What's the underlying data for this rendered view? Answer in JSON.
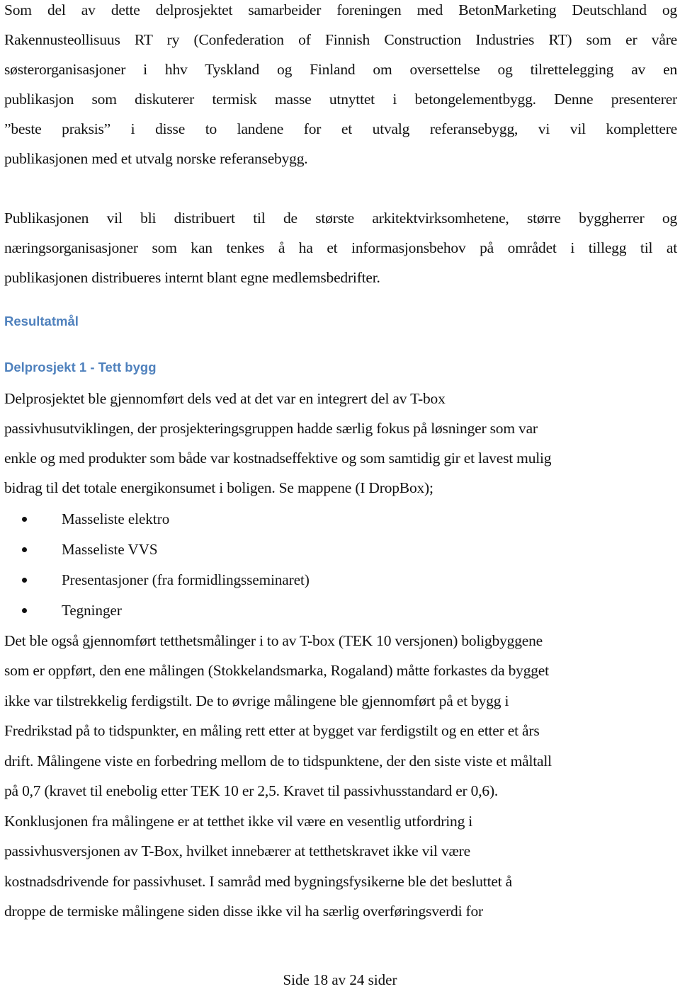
{
  "document": {
    "paragraph1": [
      "Som del av dette delprosjektet samarbeider foreningen med BetonMarketing Deutschland og",
      "Rakennusteollisuus RT ry (Confederation of Finnish Construction Industries RT) som er våre",
      "søsterorganisasjoner i hhv Tyskland og Finland om oversettelse og tilrettelegging av en",
      "publikasjon som diskuterer termisk masse utnyttet i betongelementbygg. Denne presenterer",
      "”beste praksis” i disse to landene for et utvalg referansebygg, vi vil komplettere",
      "publikasjonen med et utvalg norske referansebygg."
    ],
    "paragraph2": [
      "Publikasjonen vil bli distribuert til de største arkitektvirksomhetene, større byggherrer og",
      "næringsorganisasjoner som kan tenkes å ha et informasjonsbehov på området i tillegg til at",
      "publikasjonen distribueres internt blant egne medlemsbedrifter."
    ],
    "heading1": "Resultatmål",
    "heading2": "Delprosjekt 1 - Tett bygg",
    "paragraph3": [
      "Delprosjektet ble gjennomført dels ved at det var en integrert del av T-box",
      "passivhusutviklingen, der prosjekteringsgruppen hadde særlig fokus på løsninger som var",
      "enkle og med produkter som både var kostnadseffektive og som samtidig gir et lavest mulig",
      "bidrag til det totale energikonsumet i boligen. Se mappene (I DropBox);"
    ],
    "bullets": [
      "Masseliste elektro",
      "Masseliste VVS",
      "Presentasjoner (fra formidlingsseminaret)",
      "Tegninger"
    ],
    "paragraph4": [
      "Det ble også gjennomført tetthetsmålinger i to av T-box (TEK 10 versjonen) boligbyggene",
      "som er oppført, den ene målingen (Stokkelandsmarka, Rogaland) måtte forkastes da bygget",
      "ikke var tilstrekkelig ferdigstilt. De to øvrige målingene ble gjennomført på et bygg i",
      "Fredrikstad på to tidspunkter, en måling rett etter at bygget var ferdigstilt og en etter et  års",
      "drift. Målingene viste en forbedring mellom de to tidspunktene, der den siste viste et måltall",
      "på 0,7 (kravet til enebolig etter TEK 10 er 2,5. Kravet til passivhusstandard er 0,6)."
    ],
    "paragraph5": [
      "Konklusjonen fra målingene er at tetthet ikke vil være en vesentlig utfordring i",
      "passivhusversjonen av T-Box, hvilket innebærer at tetthetskravet ikke vil være",
      "kostnadsdrivende for passivhuset. I samråd med bygningsfysikerne ble det besluttet å",
      "droppe de termiske målingene siden disse ikke vil ha særlig overføringsverdi for"
    ],
    "footer": "Side 18 av 24 sider",
    "heading_color": "#4f81bd"
  }
}
